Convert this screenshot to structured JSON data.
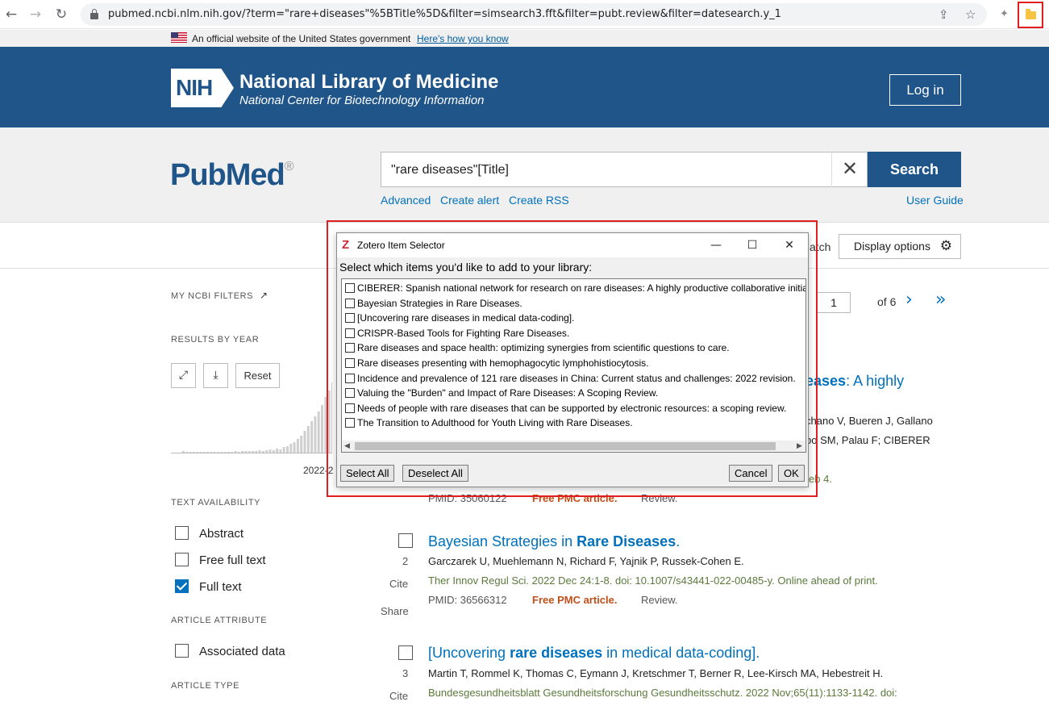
{
  "browser": {
    "url": "pubmed.ncbi.nlm.nih.gov/?term=\"rare+diseases\"%5BTitle%5D&filter=simsearch3.fft&filter=pubt.review&filter=datesearch.y_1",
    "back_icon": "←",
    "forward_icon": "→",
    "reload_icon": "↻",
    "share_icon": "⇪",
    "star_icon": "☆",
    "ext_icon": "✦"
  },
  "gov_banner": {
    "text": "An official website of the United States government",
    "link": "Here's how you know"
  },
  "nih": {
    "logo": "NIH",
    "title": "National Library of Medicine",
    "subtitle": "National Center for Biotechnology Information",
    "login": "Log in"
  },
  "search": {
    "logo": "PubMed",
    "logo_reg": "®",
    "query": "\"rare diseases\"[Title]",
    "clear": "✕",
    "button": "Search",
    "advanced": "Advanced",
    "create_alert": "Create alert",
    "create_rss": "Create RSS",
    "user_guide": "User Guide"
  },
  "actions": {
    "match_partial": "atch",
    "display_options": "Display options",
    "gear": "⚙"
  },
  "sidebar": {
    "my_filters": "MY NCBI FILTERS",
    "ext_icon": "↗",
    "results_by_year": "RESULTS BY YEAR",
    "expand_icon": "⤢",
    "download_icon": "⤓",
    "reset": "Reset",
    "year_label": "2022-2",
    "text_availability": "TEXT AVAILABILITY",
    "abstract": "Abstract",
    "free_full_text": "Free full text",
    "full_text": "Full text",
    "article_attribute": "ARTICLE ATTRIBUTE",
    "associated_data": "Associated data",
    "article_type": "ARTICLE TYPE"
  },
  "pagination": {
    "page": "1",
    "of": "of 6",
    "next": "›",
    "last": "»"
  },
  "results": {
    "r1": {
      "title_tail": "eases",
      "title_rest": ": A highly",
      "authors_a": "chano V, Bueren J, Gallano",
      "authors_b": "bo SM, Palau F; CIBERER",
      "journal_tail": "eb 4.",
      "pmid": "PMID: 35060122",
      "free": "Free PMC article.",
      "review": "Review."
    },
    "r2": {
      "num": "2",
      "title_a": "Bayesian Strategies in ",
      "title_b": "Rare Diseases",
      "title_c": ".",
      "authors": "Garczarek U, Muehlemann N, Richard F, Yajnik P, Russek-Cohen E.",
      "journal": "Ther Innov Regul Sci. 2022 Dec 24:1-8. doi: 10.1007/s43441-022-00485-y. Online ahead of print.",
      "pmid": "PMID: 36566312",
      "free": "Free PMC article.",
      "review": "Review.",
      "cite": "Cite",
      "share": "Share"
    },
    "r3": {
      "num": "3",
      "title_a": "[Uncovering ",
      "title_b": "rare diseases",
      "title_c": " in medical data-coding].",
      "authors": "Martin T, Rommel K, Thomas C, Eymann J, Kretschmer T, Berner R, Lee-Kirsch MA, Hebestreit H.",
      "journal": "Bundesgesundheitsblatt Gesundheitsforschung Gesundheitsschutz. 2022 Nov;65(11):1133-1142. doi:",
      "cite": "Cite"
    }
  },
  "dialog": {
    "title": "Zotero Item Selector",
    "z": "Z",
    "minimize": "—",
    "maximize": "☐",
    "close": "✕",
    "prompt": "Select which items you'd like to add to your library:",
    "items": [
      "CIBERER: Spanish national network for research on rare diseases: A highly productive collaborative initia",
      "Bayesian Strategies in Rare Diseases.",
      "[Uncovering rare diseases in medical data-coding].",
      "CRISPR-Based Tools for Fighting Rare Diseases.",
      "Rare diseases and space health: optimizing synergies from scientific questions to care.",
      "Rare diseases presenting with hemophagocytic lymphohistiocytosis.",
      "Incidence and prevalence of 121 rare diseases in China: Current status and challenges: 2022 revision.",
      "Valuing the \"Burden\" and Impact of Rare Diseases: A Scoping Review.",
      "Needs of people with rare diseases that can be supported by electronic resources: a scoping review.",
      "The Transition to Adulthood for Youth Living with Rare Diseases."
    ],
    "scroll_left": "◀",
    "scroll_right": "▶",
    "select_all": "Select All",
    "deselect_all": "Deselect All",
    "cancel": "Cancel",
    "ok": "OK"
  },
  "colors": {
    "nih_blue": "#20558a",
    "link_blue": "#0071bc",
    "free_orange": "#c05018",
    "highlight_red": "#e02020"
  }
}
